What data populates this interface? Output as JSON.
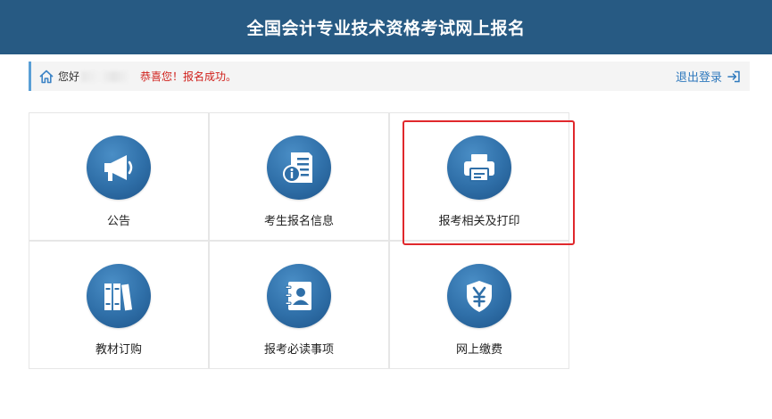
{
  "header": {
    "title": "全国会计专业技术资格考试网上报名"
  },
  "status": {
    "greeting": "您好",
    "message": "恭喜您！报名成功。",
    "logout_label": "退出登录"
  },
  "tiles": [
    {
      "label": "公告",
      "icon": "megaphone-icon"
    },
    {
      "label": "考生报名信息",
      "icon": "info-document-icon"
    },
    {
      "label": "报考相关及打印",
      "icon": "printer-icon",
      "highlighted": true
    },
    {
      "label": "教材订购",
      "icon": "books-icon"
    },
    {
      "label": "报考必读事项",
      "icon": "contact-book-icon"
    },
    {
      "label": "网上缴费",
      "icon": "yen-shield-icon"
    }
  ],
  "colors": {
    "header_bg": "#275a83",
    "accent_blue": "#2f79bd",
    "success_red": "#d0201b",
    "highlight_red": "#e0282c"
  }
}
